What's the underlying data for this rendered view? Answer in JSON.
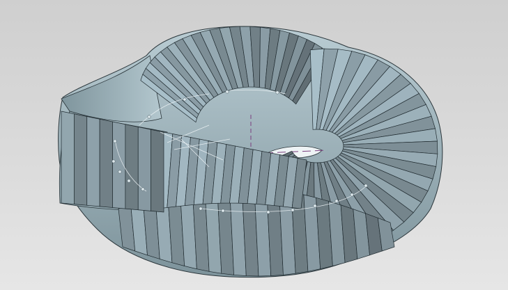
{
  "viewport": {
    "background_top": "#cfcfcf",
    "background_bottom": "#e6e6e6"
  },
  "model": {
    "name_icon": "twisted-mobius-surface",
    "fill_color": "#a9c0c8",
    "fill_light": "#d3e3e8",
    "fill_dark": "#6f858d",
    "edge_color": "#1f2a2f",
    "hidden_line_color": "#f2f7f9",
    "axis_color": "#7a3f7f",
    "ridge_facets": 50
  }
}
